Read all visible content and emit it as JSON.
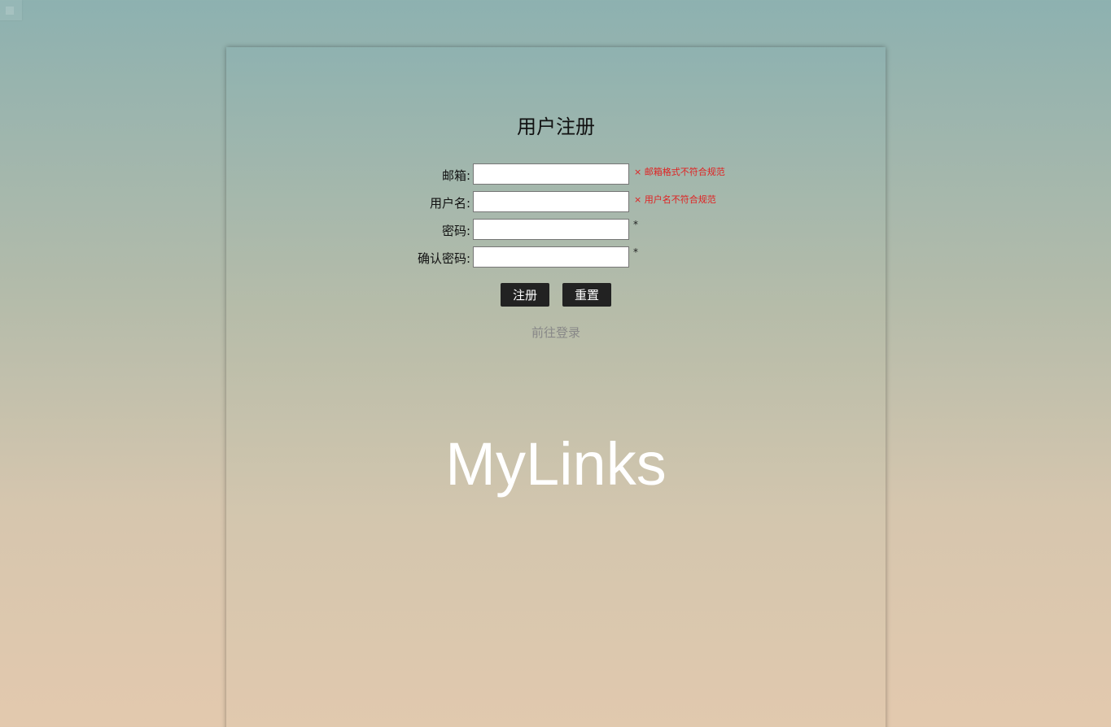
{
  "page": {
    "title": "用户注册",
    "brand": "MyLinks"
  },
  "form": {
    "email": {
      "label": "邮箱:",
      "value": "",
      "error": "× 邮箱格式不符合规范"
    },
    "username": {
      "label": "用户名:",
      "value": "",
      "error": "× 用户名不符合规范"
    },
    "password": {
      "label": "密码:",
      "value": "",
      "required_mark": "*"
    },
    "confirm_password": {
      "label": "确认密码:",
      "value": "",
      "required_mark": "*"
    }
  },
  "buttons": {
    "register": "注册",
    "reset": "重置"
  },
  "links": {
    "go_login": "前往登录"
  },
  "colors": {
    "error": "#e02020",
    "button_bg": "#222222",
    "link": "#888888",
    "brand": "#ffffff"
  },
  "icons": {
    "corner": "square-icon"
  }
}
